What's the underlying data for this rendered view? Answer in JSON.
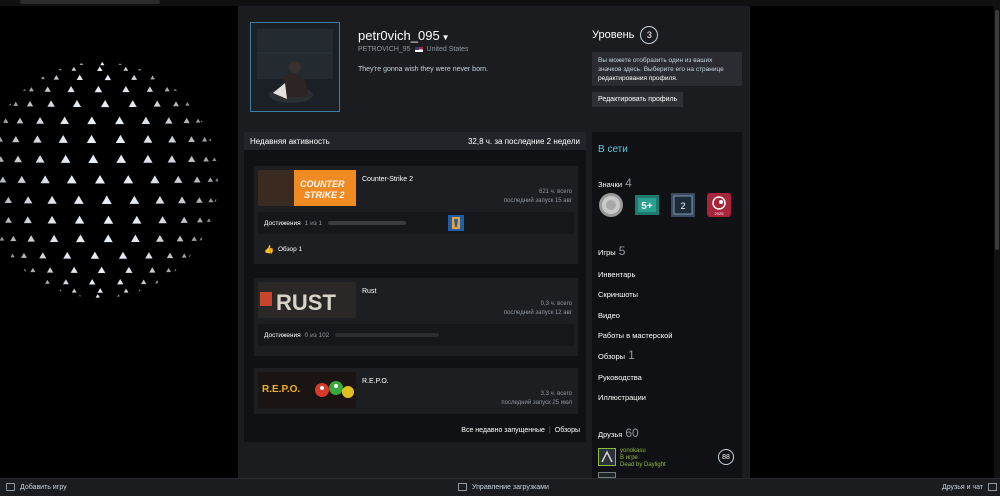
{
  "profile": {
    "persona_name": "petr0vich_095",
    "real_name": "PETROVICH_95",
    "country": "United States",
    "summary": "They're gonna wish they were never born."
  },
  "level": {
    "title": "Уровень",
    "value": "3",
    "hint_line1": "Вы можете отобразить один из ваших",
    "hint_line2": "значков здесь. Выберите его на странице",
    "hint_line3": "редактирования профиля",
    "hint_end": ".",
    "edit_button": "Редактировать профиль"
  },
  "activity": {
    "title": "Недавняя активность",
    "summary": "32,8 ч. за последние 2 недели",
    "games": [
      {
        "name": "Counter-Strike 2",
        "capsule_text": "COUNTER STRIKE 2",
        "hours_total": "621 ч. всего",
        "last_played": "последний запуск 15 авг",
        "achievements_label": "Достижения",
        "achievements_count": "1 из 1",
        "achievements_progress": 1.0,
        "review_label": "Обзор 1"
      },
      {
        "name": "Rust",
        "capsule_text": "RUST",
        "hours_total": "0,3 ч. всего",
        "last_played": "последний запуск 12 авг",
        "achievements_label": "Достижения",
        "achievements_count": "0 из 102",
        "achievements_progress": 0.0
      },
      {
        "name": "R.E.P.O.",
        "capsule_text": "R.E.P.O.",
        "hours_total": "3,3 ч. всего",
        "last_played": "последний запуск 25 июл"
      }
    ],
    "footer_all": "Все недавно запущенные",
    "footer_sep": "|",
    "footer_reviews": "Обзоры"
  },
  "sidebar": {
    "status": "В сети",
    "badges_label": "Значки",
    "badges_count": "4",
    "badge_1": "5+",
    "badge_2": "2",
    "badge_3": "2025",
    "games_label": "Игры",
    "games_count": "5",
    "inventory": "Инвентарь",
    "screenshots": "Скриншоты",
    "videos": "Видео",
    "workshop": "Работы в мастерской",
    "reviews_label": "Обзоры",
    "reviews_count": "1",
    "guides": "Руководства",
    "artwork": "Иллюстрации",
    "friends_label": "Друзья",
    "friends_count": "60",
    "friends": [
      {
        "name": "yonokasu",
        "status": "В игре",
        "game": "Dead by Daylight",
        "level": "88"
      }
    ]
  },
  "bottombar": {
    "add_game": "Добавить игру",
    "downloads": "Управление загрузками",
    "friends_chat": "Друзья и чат"
  },
  "colors": {
    "accent_blue": "#57cbde",
    "ingame_green": "#8fb93b",
    "panel": "#1b1c20"
  }
}
